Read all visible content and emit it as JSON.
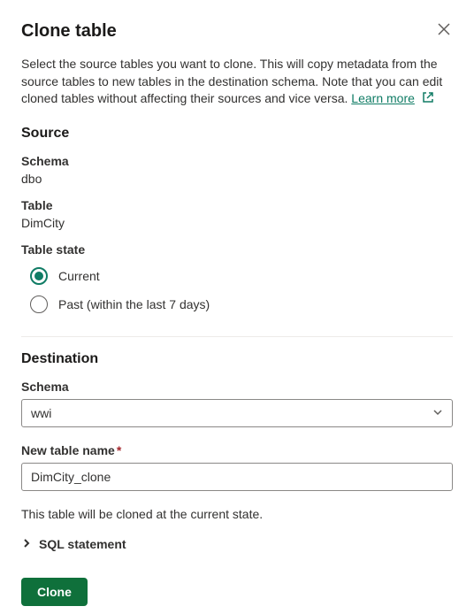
{
  "dialog": {
    "title": "Clone table",
    "description_prefix": "Select the source tables you want to clone. This will copy metadata from the source tables to new tables in the destination schema. Note that you can edit cloned tables without affecting their sources and vice versa. ",
    "learn_more": "Learn more"
  },
  "source": {
    "heading": "Source",
    "schema_label": "Schema",
    "schema_value": "dbo",
    "table_label": "Table",
    "table_value": "DimCity",
    "state_label": "Table state",
    "radio_current": "Current",
    "radio_past": "Past (within the last 7 days)"
  },
  "destination": {
    "heading": "Destination",
    "schema_label": "Schema",
    "schema_value": "wwi",
    "new_table_label": "New table name",
    "new_table_value": "DimCity_clone"
  },
  "info_text": "This table will be cloned at the current state.",
  "sql_statement_label": "SQL statement",
  "actions": {
    "clone": "Clone"
  }
}
